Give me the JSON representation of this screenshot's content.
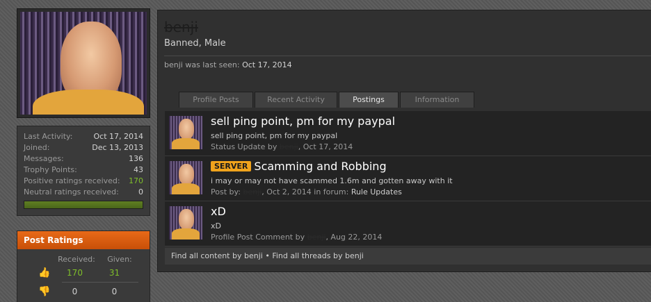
{
  "profile": {
    "username": "benji",
    "user_title": "Banned, Male",
    "last_seen_text": "benji was last seen:",
    "last_seen_date": "Oct 17, 2014"
  },
  "stats": [
    {
      "label": "Last Activity:",
      "value": "Oct 17, 2014"
    },
    {
      "label": "Joined:",
      "value": "Dec 13, 2013"
    },
    {
      "label": "Messages:",
      "value": "136"
    },
    {
      "label": "Trophy Points:",
      "value": "43"
    },
    {
      "label": "Positive ratings received:",
      "value": "170"
    },
    {
      "label": "Neutral ratings received:",
      "value": "0"
    }
  ],
  "post_ratings": {
    "title": "Post Ratings",
    "received_label": "Received:",
    "given_label": "Given:",
    "rows": [
      {
        "icon": "thumbs-up-icon",
        "received": "170",
        "given": "31"
      },
      {
        "icon": "thumbs-down-icon",
        "received": "0",
        "given": "0"
      }
    ]
  },
  "tabs": [
    {
      "label": "Profile Posts",
      "active": false
    },
    {
      "label": "Recent Activity",
      "active": false
    },
    {
      "label": "Postings",
      "active": true
    },
    {
      "label": "Information",
      "active": false
    }
  ],
  "posts": [
    {
      "prefix": "",
      "title": "sell ping point, pm for my paypal",
      "snippet": "sell ping point, pm for my paypal",
      "meta_prefix": "Status Update by",
      "author": "benji",
      "date": ", Oct 17, 2014",
      "forum_text": "",
      "forum": ""
    },
    {
      "prefix": "SERVER",
      "title": "Scamming and Robbing",
      "snippet": "i may or may not have scammed 1.6m and gotten away with it",
      "meta_prefix": "Post by:",
      "author": "benji",
      "date": ", Oct 2, 2014 in forum:",
      "forum": "Rule Updates"
    },
    {
      "prefix": "",
      "title": "xD",
      "snippet": "xD",
      "meta_prefix": "Profile Post Comment by",
      "author": "benji",
      "date": ", Aug 22, 2014",
      "forum": ""
    }
  ],
  "footer": {
    "find_content": "Find all content by benji",
    "separator": " • ",
    "find_threads": "Find all threads by benji"
  },
  "colors": {
    "accent": "#e86a18",
    "positive": "#7fbf2a",
    "prefix": "#f0a31c"
  }
}
